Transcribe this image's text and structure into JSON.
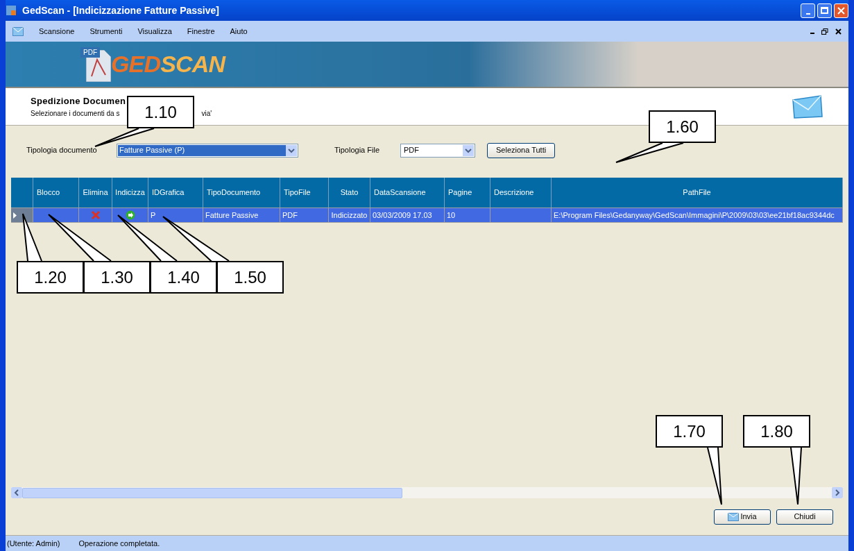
{
  "window": {
    "title": "GedScan - [Indicizzazione Fatture Passive]"
  },
  "menu": [
    "Scansione",
    "Strumenti",
    "Visualizza",
    "Finestre",
    "Aiuto"
  ],
  "banner": {
    "badge": "PDF",
    "logo_part_1": "GED",
    "logo_part_2": "SCAN"
  },
  "header": {
    "title": "Spedizione Documen",
    "subtitle_start": "Selezionare i documenti da s",
    "subtitle_end": "via'"
  },
  "filters": {
    "document_type_label": "Tipologia documento",
    "document_type_value": "Fatture Passive (P)",
    "file_type_label": "Tipologia File",
    "file_type_value": "PDF",
    "select_all_button": "Seleziona Tutti"
  },
  "table": {
    "columns": [
      "Blocco",
      "Elimina",
      "Indicizza",
      "IDGrafica",
      "TipoDocumento",
      "TipoFile",
      "Stato",
      "DataScansione",
      "Pagine",
      "Descrizione",
      "PathFile"
    ],
    "rows": [
      {
        "selected": true,
        "blocco": "",
        "id_grafica": "P",
        "tipo_documento": "Fatture Passive",
        "tipo_file": "PDF",
        "stato": "Indicizzato",
        "data_scansione": "03/03/2009 17.03",
        "pagine": "10",
        "descrizione": "",
        "path_file": "E:\\Program Files\\Gedanyway\\GedScan\\Immagini\\P\\2009\\03\\03\\ee21bf18ac9344dc"
      }
    ]
  },
  "buttons": [
    "Invia",
    "Chiudi"
  ],
  "status_bar": [
    "(Utente: Admin)",
    "Operazione completata."
  ],
  "callouts": [
    "1.10",
    "1.60",
    "1.20",
    "1.30",
    "1.40",
    "1.50",
    "1.70",
    "1.80"
  ]
}
